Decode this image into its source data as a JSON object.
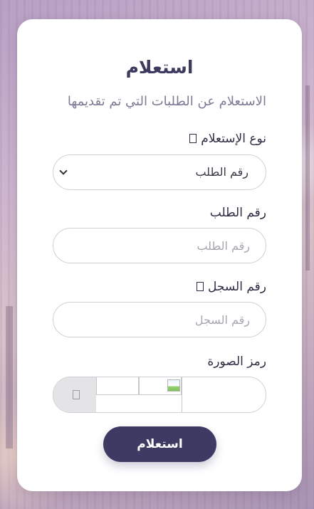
{
  "form": {
    "title": "استعلام",
    "subtitle": "الاستعلام عن الطلبات التي تم تقديمها",
    "inquiry_type": {
      "label": "نوع الإستعلام",
      "selected": "رقم الطلب"
    },
    "request_number": {
      "label": "رقم الطلب",
      "placeholder": "رقم الطلب"
    },
    "record_number": {
      "label": "رقم السجل",
      "placeholder": "رقم السجل"
    },
    "captcha": {
      "label": "رمز الصورة"
    },
    "submit_label": "استعلام"
  },
  "icons": {
    "help": "help-icon",
    "dropdown": "chevron-down-icon",
    "refresh": "refresh-icon",
    "broken_image": "broken-image-icon"
  },
  "colors": {
    "primary": "#3d3a64",
    "title": "#3c3a5e",
    "card": "#ffffff"
  }
}
